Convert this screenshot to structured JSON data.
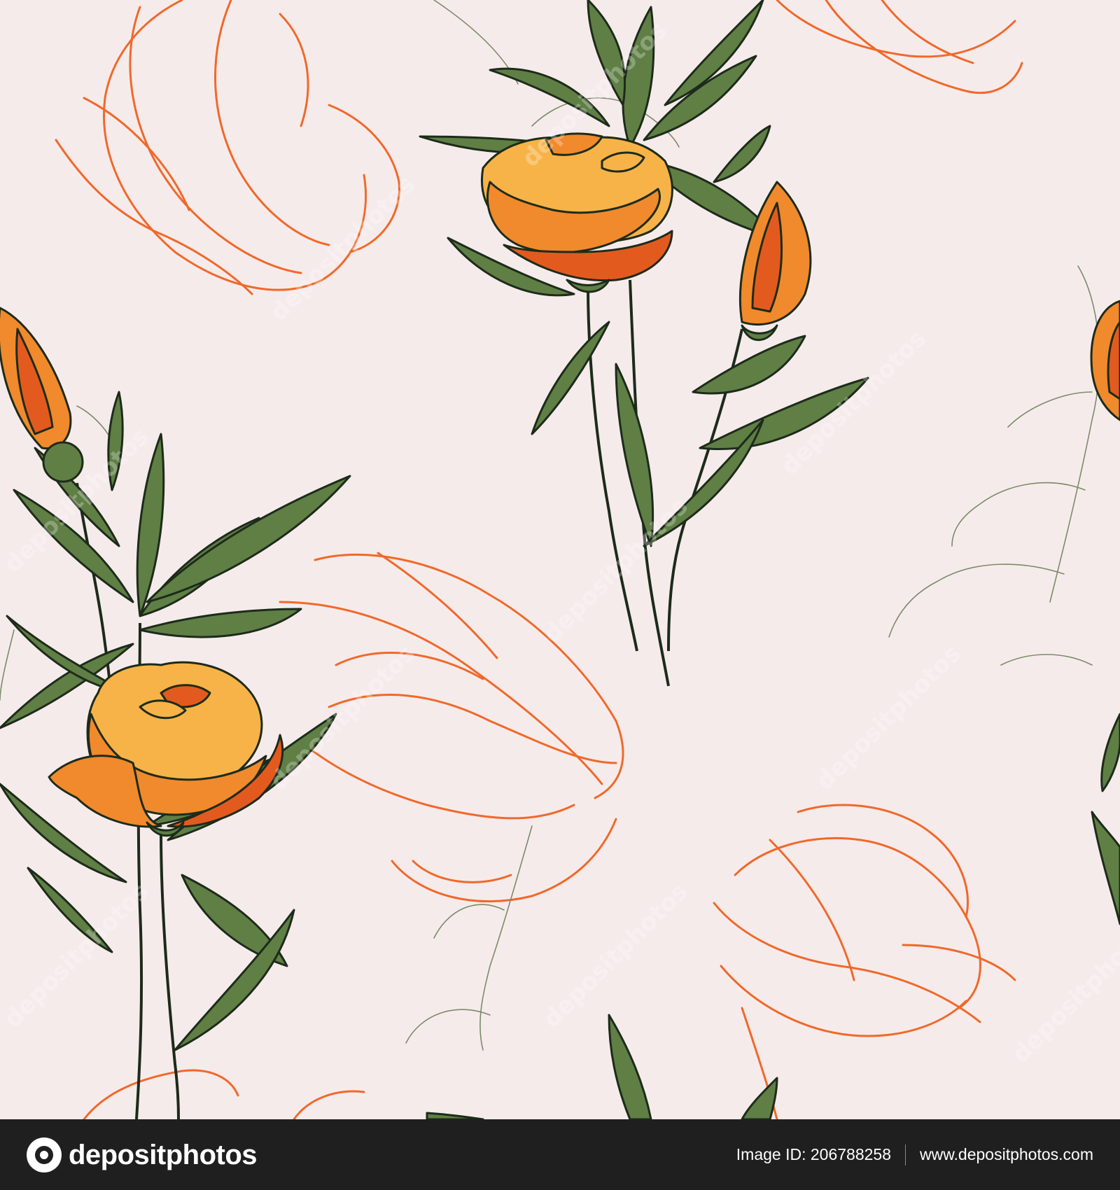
{
  "image": {
    "background_color": "#f6ebeb",
    "subject": "seamless floral pattern with orange roses, buds, green leaves and orange line-art petals"
  },
  "palette": {
    "petal_orange": "#f08a2c",
    "petal_yellow": "#f7b347",
    "petal_red": "#e35a1f",
    "leaf_green": "#5f7f45",
    "leaf_light": "#7a9a5e",
    "outline": "#1d2b1a",
    "line_art": "#f0692a",
    "stem_thin": "#7c8b6a"
  },
  "watermark": {
    "text": "depositphotos"
  },
  "footer": {
    "logo_text": "depositphotos",
    "image_id_label": "Image ID: 206788258",
    "website": "www.depositphotos.com"
  }
}
